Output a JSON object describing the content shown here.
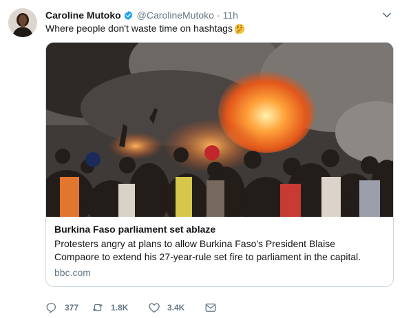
{
  "tweet": {
    "author_name": "Caroline Mutoko",
    "handle": "@CarolineMutoko",
    "separator": "·",
    "time": "11h",
    "text": "Where people don't waste time on hashtags",
    "emoji_icon": "thinking-face-icon"
  },
  "card": {
    "title": "Burkina Faso parliament set ablaze",
    "description_line1": "Protesters angry at plans to allow Burkina Faso's President Blaise",
    "description_line2": "Compaore to extend his 27-year-rule set fire to parliament in the capital.",
    "domain": "bbc.com"
  },
  "actions": {
    "reply_count": "377",
    "retweet_count": "1.8K",
    "like_count": "3.4K"
  },
  "colors": {
    "verified": "#1da1f2",
    "muted_text": "#657786",
    "card_border": "#ccd6dd"
  }
}
